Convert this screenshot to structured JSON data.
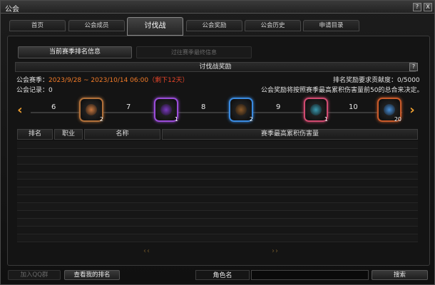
{
  "window": {
    "title": "公会",
    "help_glyph": "?",
    "close_glyph": "X"
  },
  "tabs": [
    {
      "label": "首页"
    },
    {
      "label": "公会成员"
    },
    {
      "label": "讨伐战"
    },
    {
      "label": "公会奖励"
    },
    {
      "label": "公会历史"
    },
    {
      "label": "申请目录"
    }
  ],
  "subtabs": {
    "current": "当前赛季排名信息",
    "past": "过往赛季最终信息"
  },
  "reward_bar": {
    "title": "讨伐战奖励",
    "help_glyph": "?"
  },
  "season": {
    "label": "公会赛季：",
    "range": "2023/9/28 ~ 2023/10/14 06:00",
    "remaining": "（剩下12天）",
    "requirement": "排名奖励要求贡献度：0/5000",
    "record": "公会记录：0",
    "note": "公会奖励将按照赛季最高累积伤害量前50的总合来决定。"
  },
  "reward_slider": {
    "left_arrow": "‹",
    "right_arrow": "›",
    "ranks": [
      "6",
      "7",
      "8",
      "9",
      "10"
    ],
    "rewards": [
      {
        "count": "2",
        "icon": "orange-emblem-icon",
        "border": "#b0703a",
        "glyph": "#c87840"
      },
      {
        "count": "1",
        "icon": "purple-orb-icon",
        "border": "#9a4cd8",
        "glyph": "#7a3ac0"
      },
      {
        "count": "2",
        "icon": "blue-chest-icon",
        "border": "#3a8ae0",
        "glyph": "#8a5a2a"
      },
      {
        "count": "1",
        "icon": "pink-gem-icon",
        "border": "#d04a70",
        "glyph": "#3a9ab0"
      },
      {
        "count": "20",
        "icon": "blue-stone-icon",
        "border": "#c85a2a",
        "glyph": "#4a90d8"
      }
    ]
  },
  "table": {
    "headers": [
      "排名",
      "职业",
      "名称",
      "赛季最高累积伤害量"
    ],
    "rows": [],
    "pager_prev": "‹‹",
    "pager_next": "››"
  },
  "footer": {
    "qq_button": "加入QQ群",
    "my_rank_button": "查看我的排名",
    "name_label": "角色名",
    "name_value": "",
    "search_button": "搜索"
  },
  "colors": {
    "accent_orange": "#f07a28",
    "remaining_red": "#e8452a",
    "arrow": "#f0a030"
  }
}
